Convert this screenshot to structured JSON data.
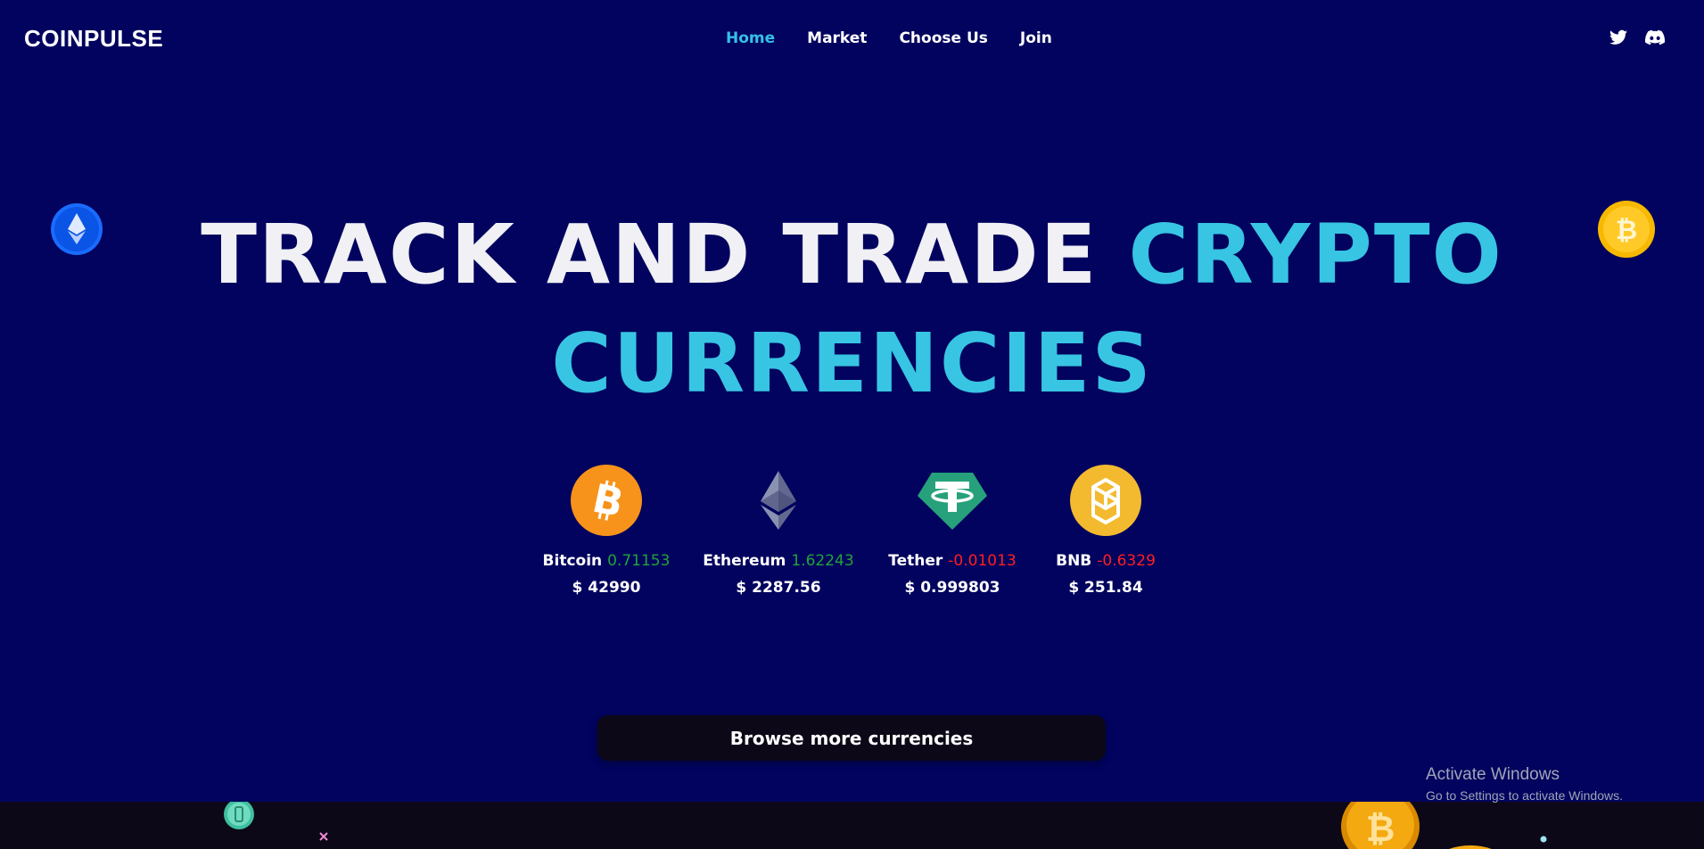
{
  "brand": {
    "logo": "COINPULSE"
  },
  "nav": {
    "items": [
      {
        "label": "Home",
        "active": true
      },
      {
        "label": "Market",
        "active": false
      },
      {
        "label": "Choose Us",
        "active": false
      },
      {
        "label": "Join",
        "active": false
      }
    ]
  },
  "socials": [
    "twitter-icon",
    "discord-icon"
  ],
  "hero": {
    "line1_white": "TRACK AND TRADE ",
    "line1_cyan": "CRYPTO",
    "line2_cyan": "CURRENCIES"
  },
  "coins": [
    {
      "name": "Bitcoin",
      "change": "0.71153",
      "trend": "up",
      "price": "$ 42990",
      "icon": "bitcoin-icon"
    },
    {
      "name": "Ethereum",
      "change": "1.62243",
      "trend": "up",
      "price": "$ 2287.56",
      "icon": "ethereum-icon"
    },
    {
      "name": "Tether",
      "change": "-0.01013",
      "trend": "down",
      "price": "$ 0.999803",
      "icon": "tether-icon"
    },
    {
      "name": "BNB",
      "change": "-0.6329",
      "trend": "down",
      "price": "$ 251.84",
      "icon": "bnb-icon"
    }
  ],
  "cta": {
    "label": "Browse more currencies"
  },
  "watermark": {
    "title": "Activate Windows",
    "subtitle": "Go to Settings to activate Windows."
  },
  "colors": {
    "background": "#01035e",
    "accent": "#38c4e3",
    "positive": "#22a33a",
    "negative": "#ff1f1f",
    "button": "#0d0818"
  }
}
